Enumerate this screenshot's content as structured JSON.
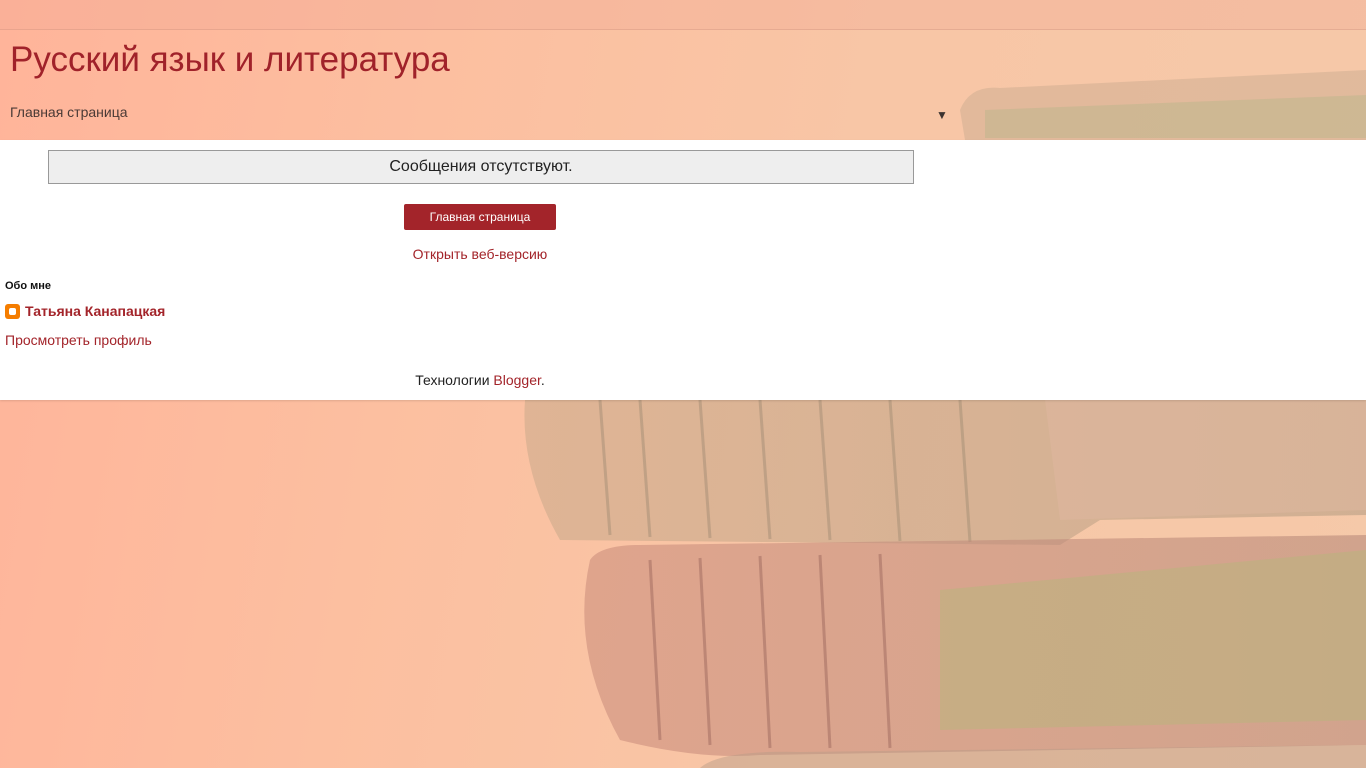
{
  "header": {
    "site_title": "Русский язык и литература",
    "nav_selected": "Главная страница",
    "nav_arrow": "▼"
  },
  "main": {
    "status_message": "Сообщения отсутствуют.",
    "home_button_label": "Главная страница",
    "web_version_link": "Открыть веб-версию"
  },
  "about": {
    "heading": "Обо мне",
    "author_name": "Татьяна Канапацкая",
    "profile_link": "Просмотреть профиль"
  },
  "footer": {
    "prefix": "Технологии",
    "blogger_link": "Blogger",
    "suffix": "."
  },
  "colors": {
    "accent": "#a3242a",
    "title": "#a0222a",
    "blogger_icon": "#f57d00"
  },
  "icons": {
    "nav_arrow": "triangle-down-icon",
    "profile": "blogger-icon"
  }
}
